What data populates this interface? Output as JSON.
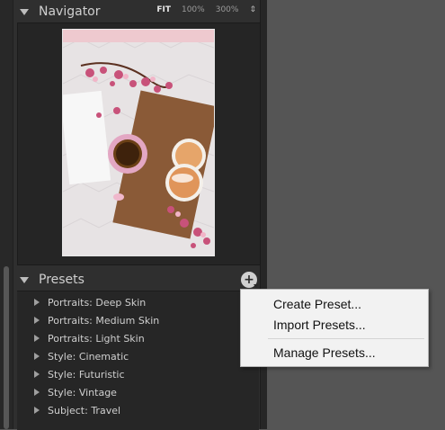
{
  "navigator": {
    "title": "Navigator",
    "zoom_options": [
      "FIT",
      "100%",
      "300%"
    ],
    "zoom_active": "FIT",
    "zoom_arrows": "⇕"
  },
  "presets": {
    "title": "Presets",
    "add_button_label": "+",
    "items": [
      {
        "label": "Portraits: Deep Skin"
      },
      {
        "label": "Portraits: Medium Skin"
      },
      {
        "label": "Portraits: Light Skin"
      },
      {
        "label": "Style: Cinematic"
      },
      {
        "label": "Style: Futuristic"
      },
      {
        "label": "Style: Vintage"
      },
      {
        "label": "Subject: Travel"
      }
    ]
  },
  "context_menu": {
    "create": "Create Preset...",
    "import": "Import Presets...",
    "manage": "Manage Presets..."
  },
  "colors": {
    "panel_bg": "#2f2f2f",
    "workspace_bg": "#555555",
    "menu_bg": "#f2f2f2"
  }
}
